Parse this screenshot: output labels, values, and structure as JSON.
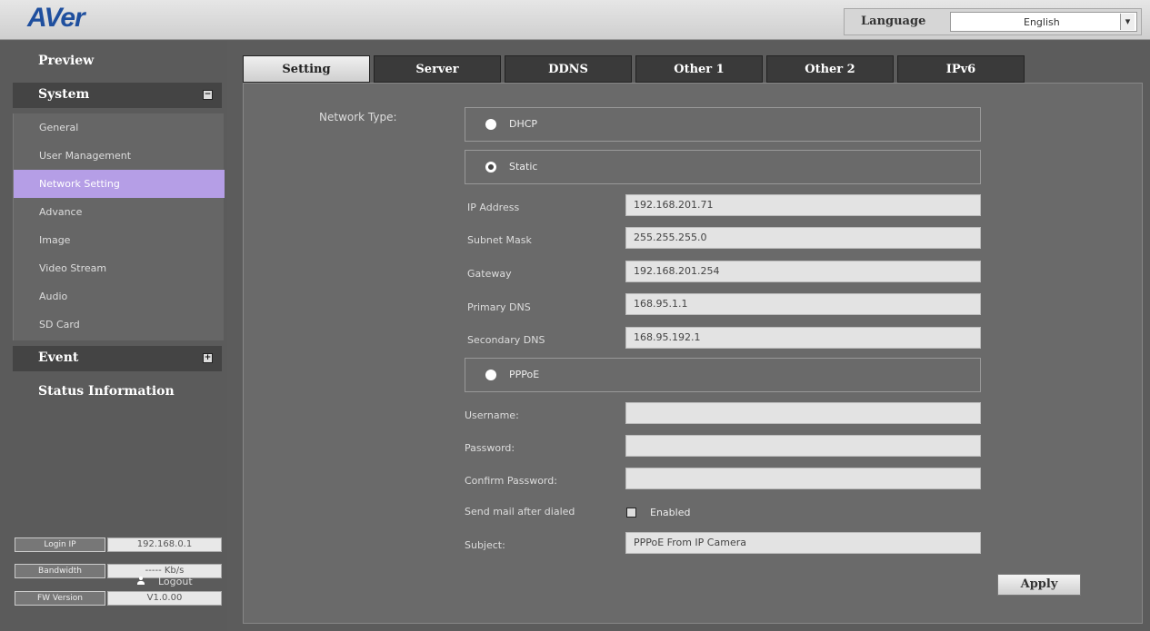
{
  "header": {
    "logo": "AVer",
    "language_label": "Language",
    "language_value": "English"
  },
  "sidebar": {
    "preview": "Preview",
    "system": "System",
    "system_toggle": "−",
    "items": [
      {
        "label": "General"
      },
      {
        "label": "User Management"
      },
      {
        "label": "Network Setting",
        "active": true
      },
      {
        "label": "Advance"
      },
      {
        "label": "Image"
      },
      {
        "label": "Video Stream"
      },
      {
        "label": "Audio"
      },
      {
        "label": "SD Card"
      }
    ],
    "event": "Event",
    "event_toggle": "+",
    "status_information": "Status Information",
    "info": {
      "login_ip_label": "Login IP",
      "login_ip_value": "192.168.0.1",
      "bandwidth_label": "Bandwidth",
      "bandwidth_value": "----- Kb/s",
      "fw_version_label": "FW Version",
      "fw_version_value": "V1.0.00"
    },
    "logout": "Logout"
  },
  "tabs": [
    {
      "label": "Setting",
      "active": true
    },
    {
      "label": "Server"
    },
    {
      "label": "DDNS"
    },
    {
      "label": "Other 1"
    },
    {
      "label": "Other 2"
    },
    {
      "label": "IPv6"
    }
  ],
  "form": {
    "network_type_label": "Network Type:",
    "dhcp": "DHCP",
    "static": "Static",
    "selected_type": "Static",
    "ip_address_label": "IP Address",
    "ip_address": "192.168.201.71",
    "subnet_mask_label": "Subnet Mask",
    "subnet_mask": "255.255.255.0",
    "gateway_label": "Gateway",
    "gateway": "192.168.201.254",
    "primary_dns_label": "Primary DNS",
    "primary_dns": "168.95.1.1",
    "secondary_dns_label": "Secondary DNS",
    "secondary_dns": "168.95.192.1",
    "pppoe": "PPPoE",
    "username_label": "Username:",
    "username": "",
    "password_label": "Password:",
    "password": "",
    "confirm_password_label": "Confirm Password:",
    "confirm_password": "",
    "send_mail_label": "Send mail after dialed",
    "enabled_label": "Enabled",
    "subject_label": "Subject:",
    "subject": "PPPoE From IP Camera",
    "apply": "Apply"
  }
}
